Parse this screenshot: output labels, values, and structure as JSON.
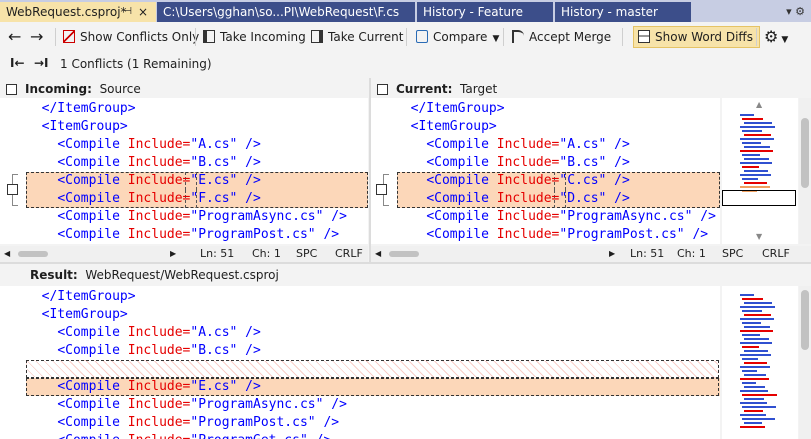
{
  "tabs": [
    {
      "label": "WebRequest.csproj*",
      "pin": "⊣",
      "close": "×"
    },
    {
      "label": "C:\\Users\\gghan\\so...PI\\WebRequest\\F.cs"
    },
    {
      "label": "History - Feature"
    },
    {
      "label": "History - master"
    }
  ],
  "tabbar_menu": "▾ ⚙",
  "toolbar": {
    "back": "←",
    "forward": "→",
    "show_conflicts_only": "Show Conflicts Only",
    "take_incoming": "Take Incoming",
    "take_current": "Take Current",
    "compare": "Compare",
    "accept_merge": "Accept Merge",
    "show_word_diffs": "Show Word Diffs",
    "settings": "⚙"
  },
  "nav": {
    "prev": "I←",
    "next": "→I",
    "conflicts": "1 Conflicts (1 Remaining)"
  },
  "incoming": {
    "label": "Incoming:",
    "source": "Source",
    "lines": [
      {
        "indent": "  ",
        "tag_open": "</ItemGroup>"
      },
      {
        "indent": "  ",
        "tag_open": "<ItemGroup>"
      },
      {
        "indent": "    ",
        "tag_open": "<Compile ",
        "attr": "Include=",
        "val": "\"A.cs\"",
        "tag_close": " />"
      },
      {
        "indent": "    ",
        "tag_open": "<Compile ",
        "attr": "Include=",
        "val": "\"B.cs\"",
        "tag_close": " />"
      },
      {
        "indent": "    ",
        "tag_open": "<Compile ",
        "attr": "Include=",
        "val": "\"E.cs\"",
        "tag_close": " />"
      },
      {
        "indent": "    ",
        "tag_open": "<Compile ",
        "attr": "Include=",
        "val": "\"F.cs\"",
        "tag_close": " />"
      },
      {
        "indent": "    ",
        "tag_open": "<Compile ",
        "attr": "Include=",
        "val": "\"ProgramAsync.cs\"",
        "tag_close": " />"
      },
      {
        "indent": "    ",
        "tag_open": "<Compile ",
        "attr": "Include=",
        "val": "\"ProgramPost.cs\"",
        "tag_close": " />"
      }
    ],
    "status": {
      "ln": "Ln: 51",
      "ch": "Ch: 1",
      "spc": "SPC",
      "crlf": "CRLF"
    }
  },
  "current": {
    "label": "Current:",
    "source": "Target",
    "lines": [
      {
        "indent": "  ",
        "tag_open": "</ItemGroup>"
      },
      {
        "indent": "  ",
        "tag_open": "<ItemGroup>"
      },
      {
        "indent": "    ",
        "tag_open": "<Compile ",
        "attr": "Include=",
        "val": "\"A.cs\"",
        "tag_close": " />"
      },
      {
        "indent": "    ",
        "tag_open": "<Compile ",
        "attr": "Include=",
        "val": "\"B.cs\"",
        "tag_close": " />"
      },
      {
        "indent": "    ",
        "tag_open": "<Compile ",
        "attr": "Include=",
        "val": "\"C.cs\"",
        "tag_close": " />"
      },
      {
        "indent": "    ",
        "tag_open": "<Compile ",
        "attr": "Include=",
        "val": "\"D.cs\"",
        "tag_close": " />"
      },
      {
        "indent": "    ",
        "tag_open": "<Compile ",
        "attr": "Include=",
        "val": "\"ProgramAsync.cs\"",
        "tag_close": " />"
      },
      {
        "indent": "    ",
        "tag_open": "<Compile ",
        "attr": "Include=",
        "val": "\"ProgramPost.cs\"",
        "tag_close": " />"
      }
    ],
    "status": {
      "ln": "Ln: 51",
      "ch": "Ch: 1",
      "spc": "SPC",
      "crlf": "CRLF"
    }
  },
  "result": {
    "label": "Result:",
    "path": "WebRequest/WebRequest.csproj",
    "lines": [
      {
        "indent": "  ",
        "tag_open": "</ItemGroup>"
      },
      {
        "indent": "  ",
        "tag_open": "<ItemGroup>"
      },
      {
        "indent": "    ",
        "tag_open": "<Compile ",
        "attr": "Include=",
        "val": "\"A.cs\"",
        "tag_close": " />"
      },
      {
        "indent": "    ",
        "tag_open": "<Compile ",
        "attr": "Include=",
        "val": "\"B.cs\"",
        "tag_close": " />"
      },
      {
        "indent": "",
        "tag_open": ""
      },
      {
        "indent": "    ",
        "tag_open": "<Compile ",
        "attr": "Include=",
        "val": "\"E.cs\"",
        "tag_close": " />"
      },
      {
        "indent": "    ",
        "tag_open": "<Compile ",
        "attr": "Include=",
        "val": "\"ProgramAsync.cs\"",
        "tag_close": " />"
      },
      {
        "indent": "    ",
        "tag_open": "<Compile ",
        "attr": "Include=",
        "val": "\"ProgramPost.cs\"",
        "tag_close": " />"
      },
      {
        "indent": "    ",
        "tag_open": "<Compile ",
        "attr": "Include=",
        "val": "\"ProgramGet.cs\"",
        "tag_close": " />"
      }
    ]
  },
  "colors": {
    "tag": "#0000ff",
    "attr": "#e50000",
    "conflict": "#fcd7b9",
    "active_tab": "#f7e3a9",
    "inactive_tab": "#3c4e8a"
  }
}
